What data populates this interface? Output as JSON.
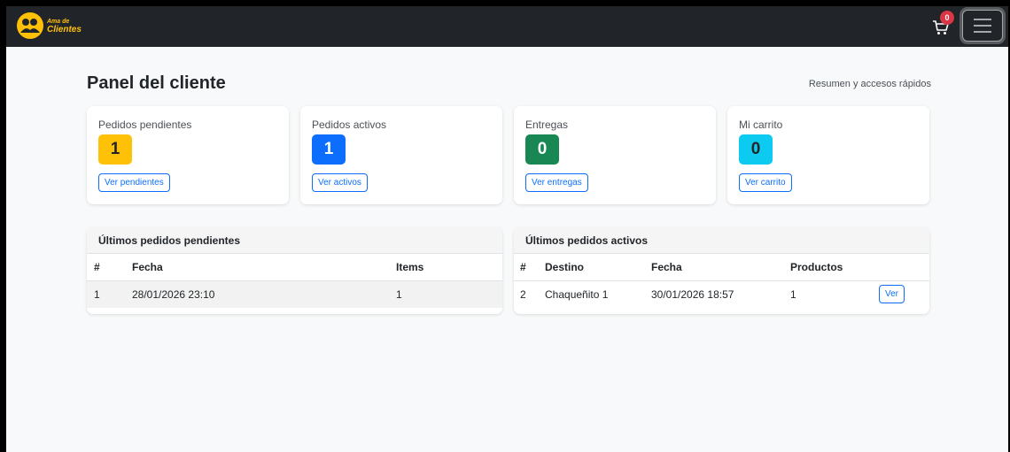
{
  "navbar": {
    "logo_small": "Ama de",
    "logo_big": "Clientes",
    "cart_count": "0"
  },
  "page": {
    "title": "Panel del cliente",
    "subtitle": "Resumen y accesos rápidos"
  },
  "stats": [
    {
      "label": "Pedidos pendientes",
      "value": "1",
      "button": "Ver pendientes",
      "color": "#ffc107"
    },
    {
      "label": "Pedidos activos",
      "value": "1",
      "button": "Ver activos",
      "color": "#0d6efd"
    },
    {
      "label": "Entregas",
      "value": "0",
      "button": "Ver entregas",
      "color": "#198754"
    },
    {
      "label": "Mi carrito",
      "value": "0",
      "button": "Ver carrito",
      "color": "#0dcaf0"
    }
  ],
  "pending_orders": {
    "title": "Últimos pedidos pendientes",
    "columns": [
      "#",
      "Fecha",
      "Items"
    ],
    "rows": [
      {
        "num": "1",
        "fecha": "28/01/2026 23:10",
        "items": "1"
      }
    ]
  },
  "active_orders": {
    "title": "Últimos pedidos activos",
    "columns": [
      "#",
      "Destino",
      "Fecha",
      "Productos"
    ],
    "rows": [
      {
        "num": "2",
        "destino": "Chaqueñito 1",
        "fecha": "30/01/2026 18:57",
        "productos": "1",
        "action": "Ver"
      }
    ]
  }
}
